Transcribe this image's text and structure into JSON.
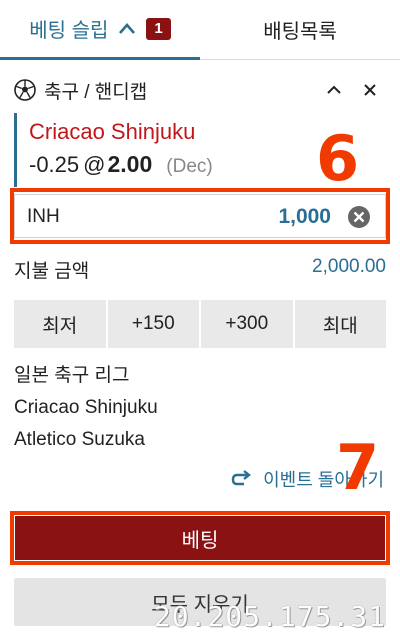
{
  "tabs": [
    {
      "label": "베팅 슬립",
      "badge": "1",
      "active": true
    },
    {
      "label": "배팅목록",
      "active": false
    }
  ],
  "selection": {
    "sport_label": "축구 / 핸디캡",
    "team": "Criacao Shinjuku",
    "handicap": "-0.25",
    "at": "@",
    "price": "2.00",
    "odds_format": "(Dec)"
  },
  "annotations": {
    "step6": "6",
    "step7": "7",
    "color": "#f03a00"
  },
  "stake": {
    "currency": "INH",
    "value": "1,000"
  },
  "payout": {
    "label": "지불 금액",
    "value": "2,000.00"
  },
  "quick_buttons": [
    "최저",
    "+150",
    "+300",
    "최대"
  ],
  "event": {
    "league": "일본 축구 리그",
    "home": "Criacao Shinjuku",
    "away": "Atletico Suzuka"
  },
  "return_link": "이벤트 돌아가기",
  "bet_button": "베팅",
  "clear_button": "모두 지우기",
  "watermark": "20.205.175.31",
  "colors": {
    "accent": "#2a6f93",
    "brand_red": "#8b1212",
    "team_red": "#c0171b"
  }
}
